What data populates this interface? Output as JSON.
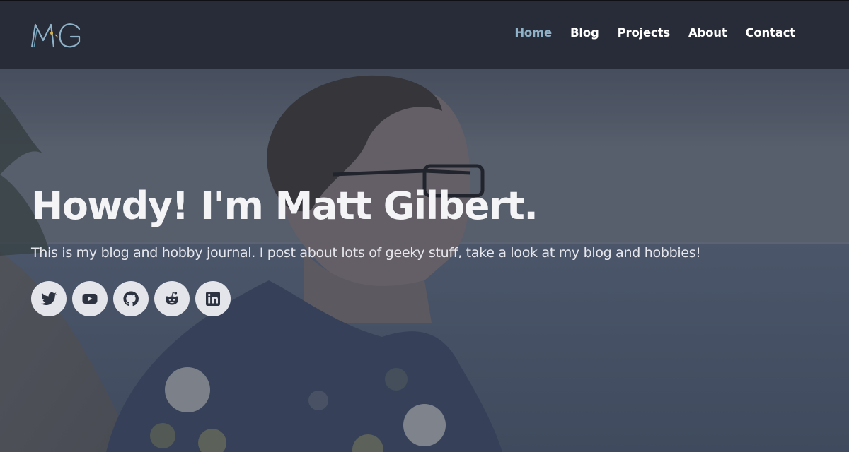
{
  "header": {
    "logo_text": "MG",
    "logo_icon": "mg-monogram-logo",
    "nav": [
      {
        "label": "Home",
        "active": true
      },
      {
        "label": "Blog",
        "active": false
      },
      {
        "label": "Projects",
        "active": false
      },
      {
        "label": "About",
        "active": false
      },
      {
        "label": "Contact",
        "active": false
      }
    ]
  },
  "hero": {
    "title": "Howdy! I'm Matt Gilbert.",
    "subtitle": "This is my blog and hobby journal. I post about lots of geeky stuff, take a look at my blog and hobbies!",
    "background_image": "photo of man in glasses and floral shirt looking out over the ocean at dusk",
    "socials": [
      {
        "icon": "twitter-icon"
      },
      {
        "icon": "youtube-icon"
      },
      {
        "icon": "github-icon"
      },
      {
        "icon": "reddit-icon"
      },
      {
        "icon": "linkedin-icon"
      }
    ]
  },
  "colors": {
    "header_bg": "#272c38",
    "nav_active": "#8fb2c8",
    "nav_text": "#ffffff",
    "social_bg": "#e4e5ea",
    "social_icon": "#2d3340"
  }
}
